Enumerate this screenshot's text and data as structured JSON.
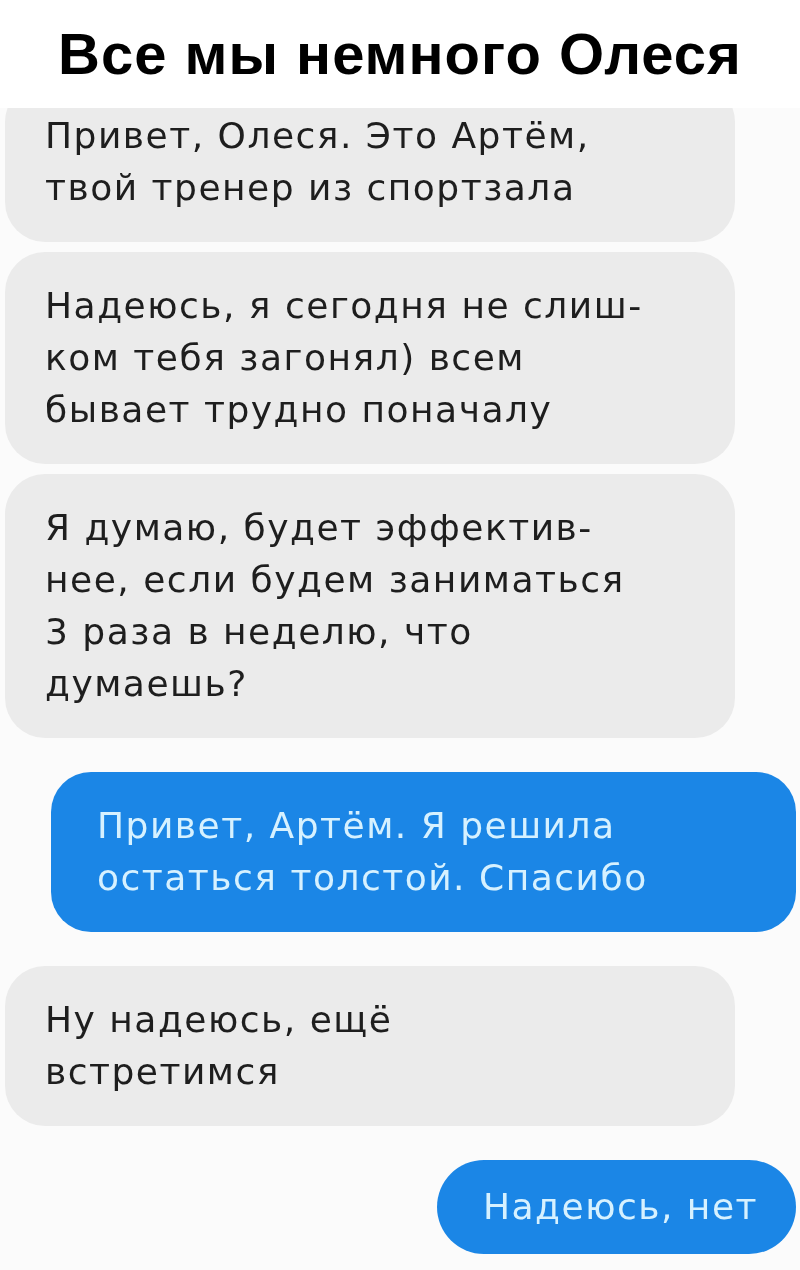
{
  "title": "Все мы немного Олеся",
  "messages": [
    {
      "kind": "incoming",
      "text": "Привет, Олеся. Это Артём,\nтвой тренер из спортзала"
    },
    {
      "kind": "incoming",
      "text": "Надеюсь, я сегодня не слиш-\nком тебя загонял) всем\nбывает трудно поначалу"
    },
    {
      "kind": "incoming",
      "text": "Я думаю, будет эффектив-\nнее, если будем заниматься\n3 раза в неделю, что\nдумаешь?"
    },
    {
      "kind": "outgoing",
      "text": "Привет, Артём. Я решила\nостаться толстой. Спасибо"
    },
    {
      "kind": "incoming",
      "text": "Ну надеюсь, ещё\nвстретимся"
    },
    {
      "kind": "outgoing",
      "text": "Надеюсь, нет"
    }
  ]
}
